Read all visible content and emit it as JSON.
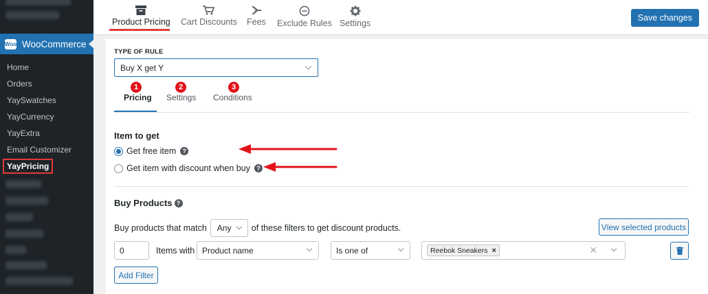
{
  "sidebar": {
    "menu_label": "WooCommerce",
    "items": [
      {
        "label": "Home"
      },
      {
        "label": "Orders"
      },
      {
        "label": "YaySwatches"
      },
      {
        "label": "YayCurrency"
      },
      {
        "label": "YayExtra"
      },
      {
        "label": "Email Customizer"
      },
      {
        "label": "YayPricing"
      }
    ]
  },
  "topbar": {
    "tabs": [
      {
        "label": "Product Pricing",
        "icon": "archive-box-icon"
      },
      {
        "label": "Cart Discounts",
        "icon": "cart-icon"
      },
      {
        "label": "Fees",
        "icon": "airplane-icon"
      },
      {
        "label": "Exclude Rules",
        "icon": "minus-circle-icon"
      },
      {
        "label": "Settings",
        "icon": "gear-icon"
      }
    ],
    "active_tab": "Product Pricing",
    "save_label": "Save changes"
  },
  "rule": {
    "type_label": "TYPE OF RULE",
    "type_value": "Buy X get Y"
  },
  "subtabs": [
    {
      "label": "Pricing",
      "badge": "1"
    },
    {
      "label": "Settings",
      "badge": "2"
    },
    {
      "label": "Conditions",
      "badge": "3"
    }
  ],
  "item_to_get": {
    "title": "Item to get",
    "options": [
      {
        "label": "Get free item",
        "checked": true
      },
      {
        "label": "Get item with discount when buy",
        "checked": false
      }
    ]
  },
  "buy_products": {
    "title": "Buy Products",
    "match_prefix": "Buy products that match",
    "match_value": "Any",
    "match_suffix": "of these filters to get discount products.",
    "view_button": "View selected products",
    "filter": {
      "quantity": "0",
      "items_with": "Items with",
      "field": "Product name",
      "operator": "Is one of",
      "values": [
        "Reebok Sneakers"
      ]
    },
    "add_filter": "Add Filter"
  },
  "colors": {
    "accent": "#2271b1",
    "annotation": "#e53935",
    "sidebar_bg": "#1d2327"
  }
}
